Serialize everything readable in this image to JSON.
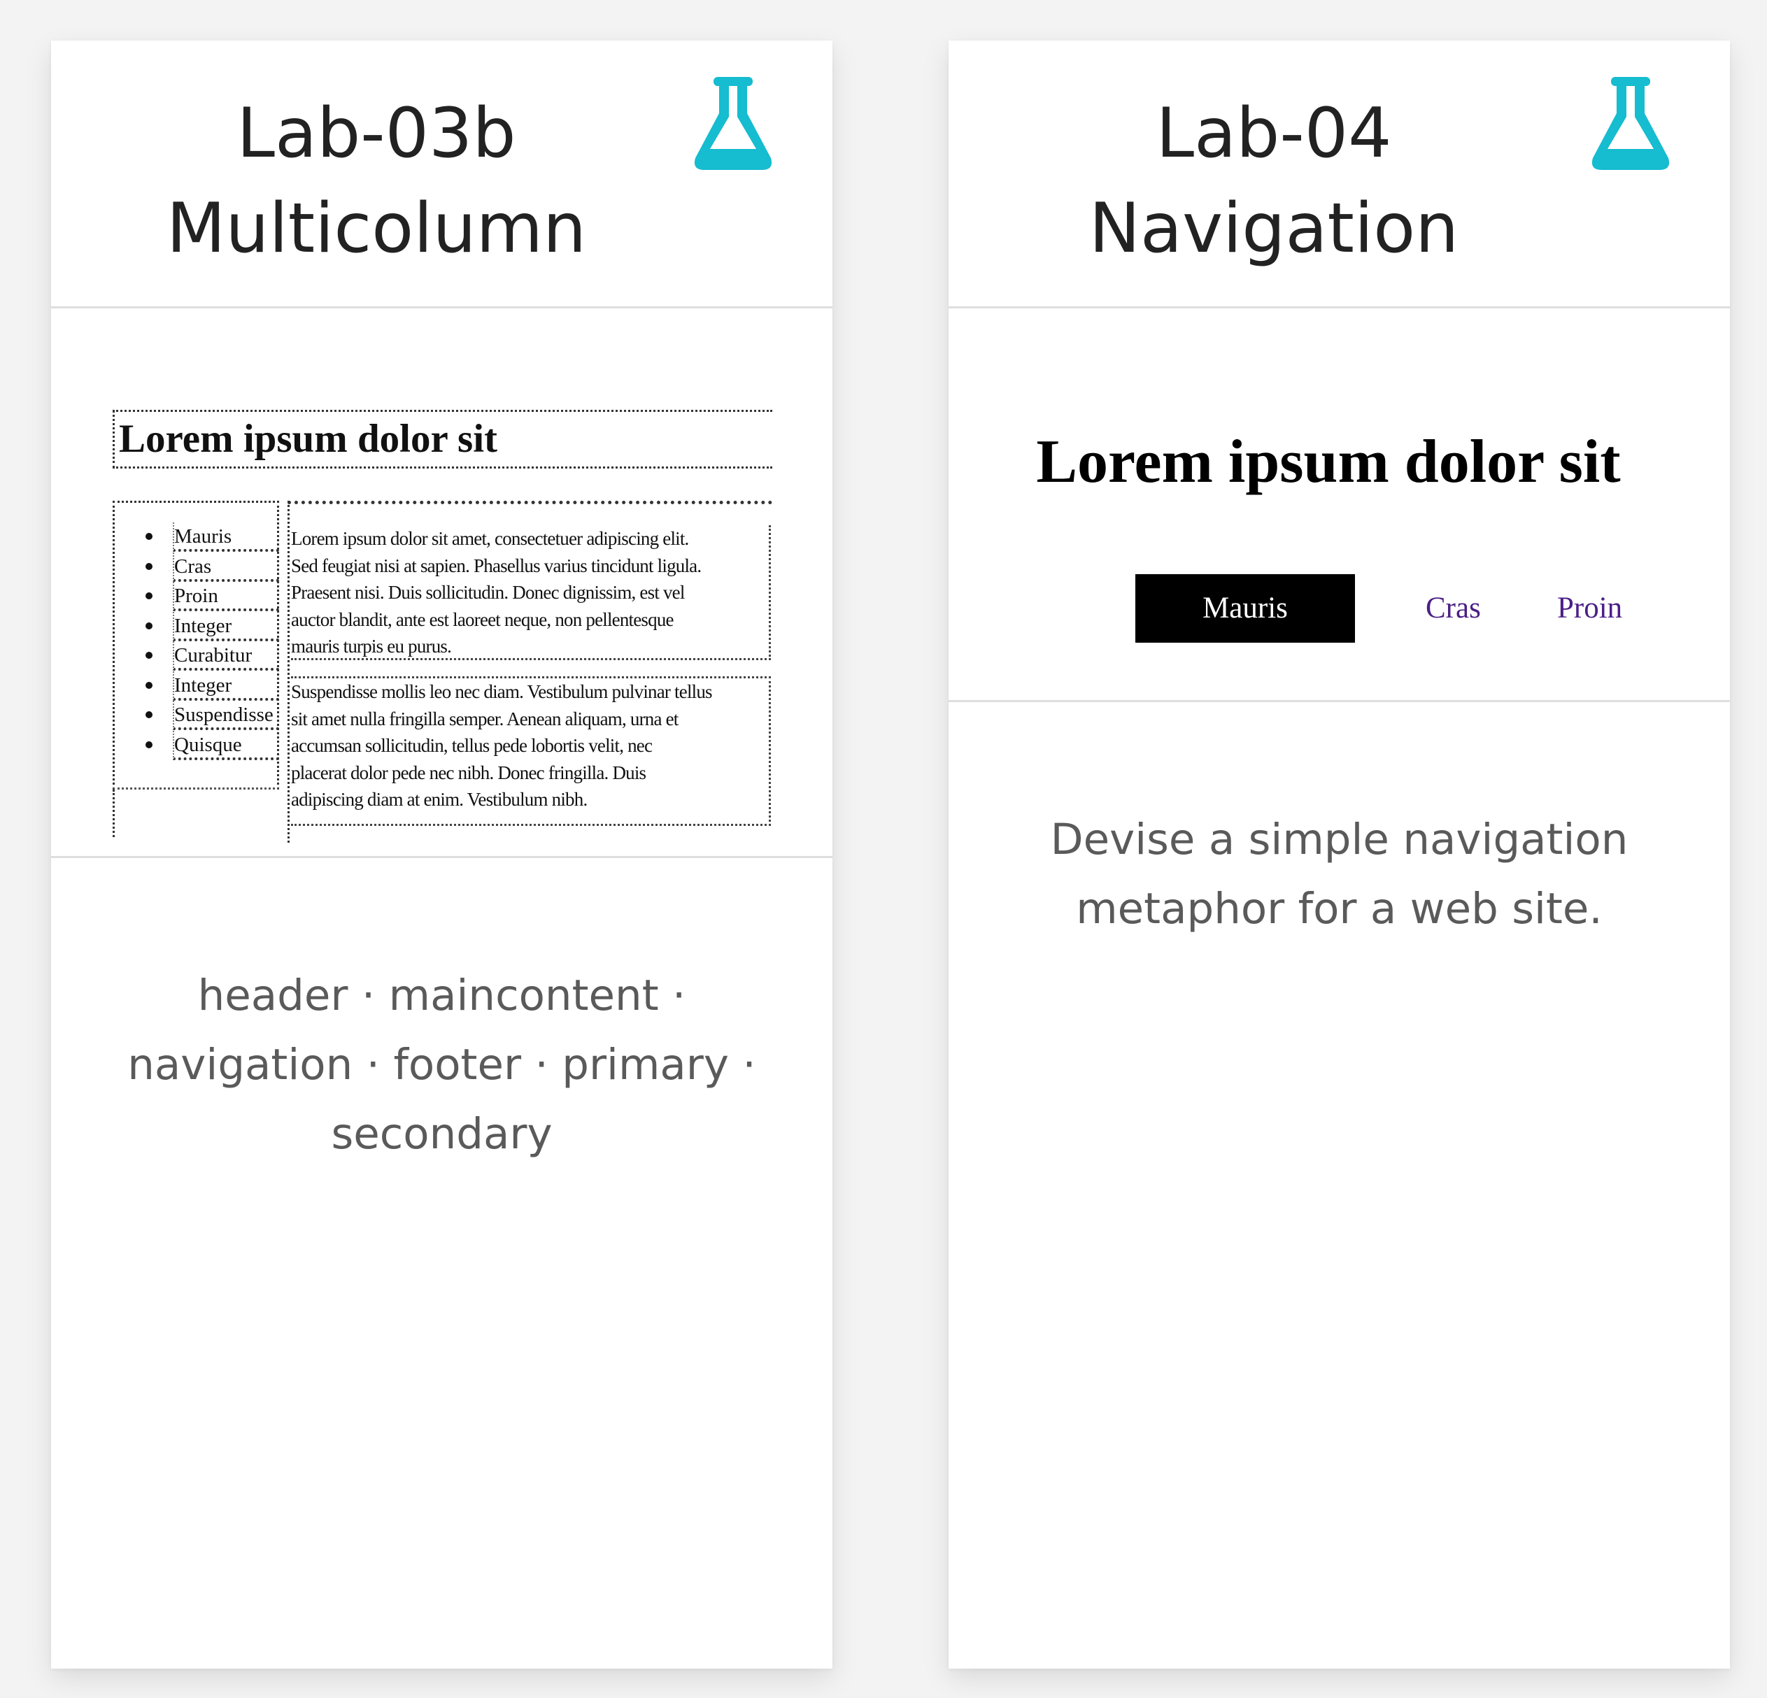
{
  "accent_color": "#16bccf",
  "cards": [
    {
      "title_line1": "Lab-03b",
      "title_line2": "Multicolumn",
      "icon": "flask-icon",
      "preview": {
        "heading": "Lorem ipsum dolor sit",
        "list_items": [
          "Mauris",
          "Cras",
          "Proin",
          "Integer",
          "Curabitur",
          "Integer",
          "Suspendisse",
          "Quisque"
        ],
        "paragraph1_lines": [
          "Lorem ipsum dolor sit amet, consectetuer adipiscing elit.",
          "Sed feugiat nisi at sapien. Phasellus varius tincidunt ligula.",
          "Praesent nisi. Duis sollicitudin. Donec dignissim, est vel",
          "auctor blandit, ante est laoreet neque, non pellentesque",
          "mauris turpis eu purus."
        ],
        "paragraph2_lines": [
          "Suspendisse mollis leo nec diam. Vestibulum pulvinar tellus",
          "sit amet nulla fringilla semper. Aenean aliquam, urna et",
          "accumsan sollicitudin, tellus pede lobortis velit, nec",
          "placerat dolor pede nec nibh. Donec fringilla. Duis",
          "adipiscing diam at enim. Vestibulum nibh."
        ]
      },
      "description_lines": [
        "header · maincontent ·",
        "navigation · footer · primary ·",
        "secondary"
      ]
    },
    {
      "title_line1": "Lab-04",
      "title_line2": "Navigation",
      "icon": "flask-icon",
      "preview": {
        "heading": "Lorem ipsum dolor sit",
        "nav_items": [
          "Mauris",
          "Cras",
          "Proin"
        ],
        "active_item": "Mauris"
      },
      "description_lines": [
        "Devise a simple navigation",
        "metaphor for a web site."
      ]
    }
  ]
}
